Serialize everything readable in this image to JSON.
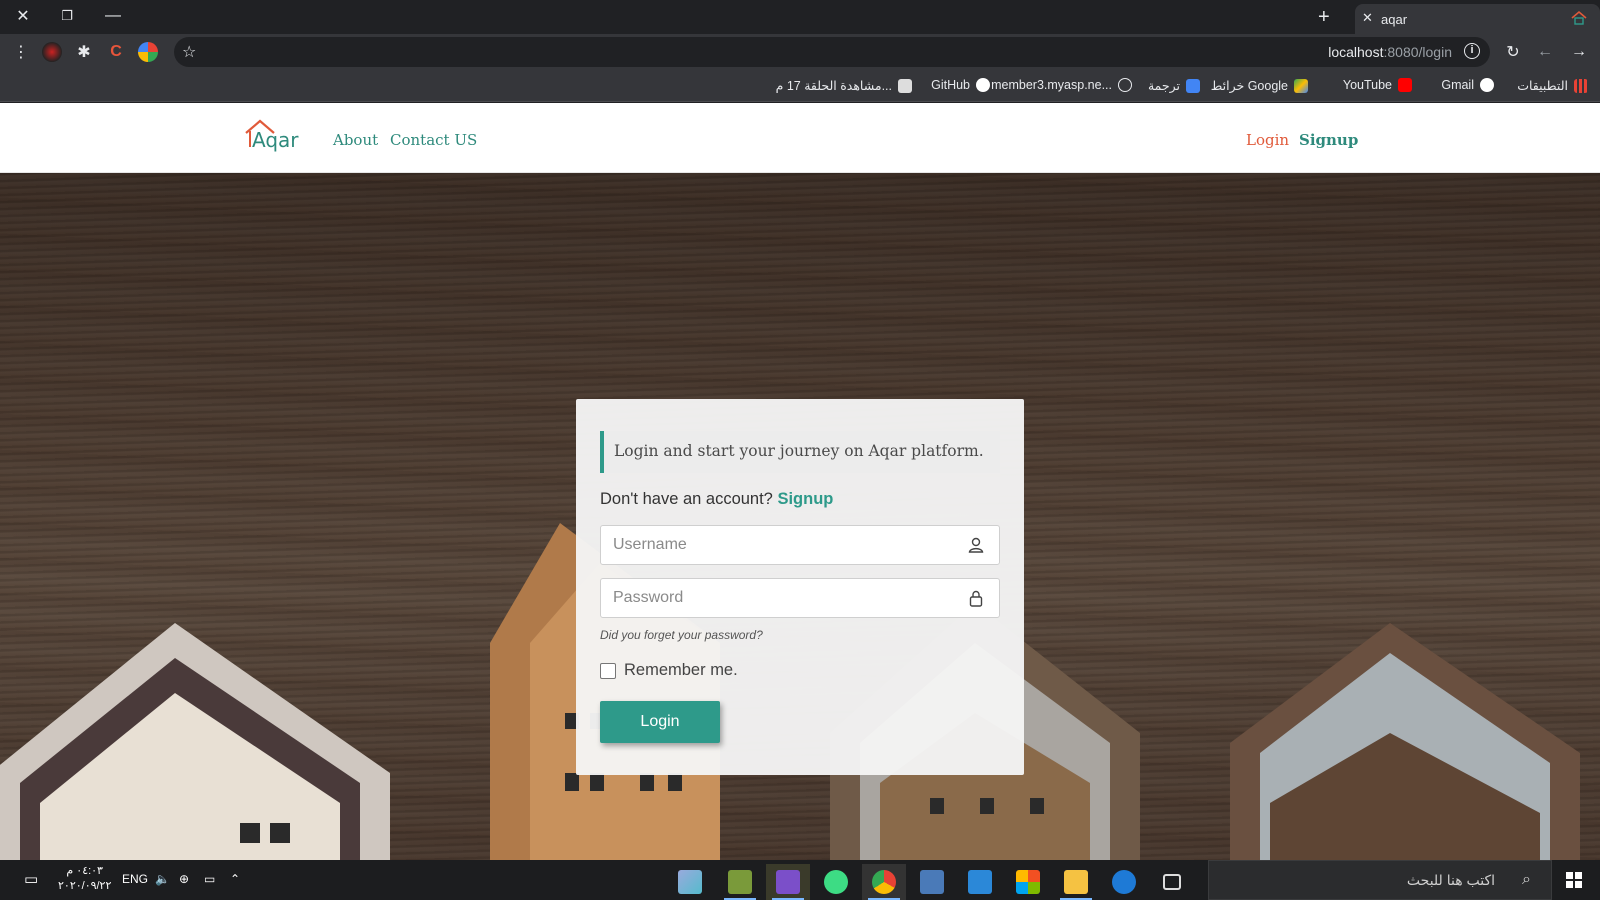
{
  "browser": {
    "tab_title": "aqar",
    "url_host": "localhost",
    "url_rest": ":8080/login",
    "bookmarks": [
      {
        "label": "التطبيقات",
        "color": "#e84235"
      },
      {
        "label": "Gmail",
        "color": "#ffffff"
      },
      {
        "label": "YouTube",
        "color": "#ff0000"
      },
      {
        "label": "خرائط Google",
        "color": "#34a853"
      },
      {
        "label": "ترجمة",
        "color": "#4285f4"
      },
      {
        "label": "member3.myasp.ne...",
        "color": "#444444"
      },
      {
        "label": "GitHub",
        "color": "#ffffff"
      },
      {
        "label": "مشاهدة الحلقة 17 م...",
        "color": "#dddddd"
      }
    ]
  },
  "site": {
    "brand": "Aqar",
    "nav": {
      "about": "About",
      "contact": "Contact US",
      "login": "Login",
      "signup": "Signup"
    },
    "colors": {
      "accent": "#2e9a8a",
      "login_link": "#e05a3a"
    }
  },
  "form": {
    "callout": "Login and start your journey on Aqar platform.",
    "no_account": "Don't have an account?",
    "signup_link": "Signup",
    "username_placeholder": "Username",
    "password_placeholder": "Password",
    "forgot": "Did you forget your password?",
    "remember": "Remember me.",
    "login_button": "Login"
  },
  "taskbar": {
    "lang": "ENG",
    "time": "٠٤:٠٣ م",
    "date": "٢٠٢٠/٠٩/٢٢",
    "search_placeholder": "اكتب هنا للبحث"
  }
}
